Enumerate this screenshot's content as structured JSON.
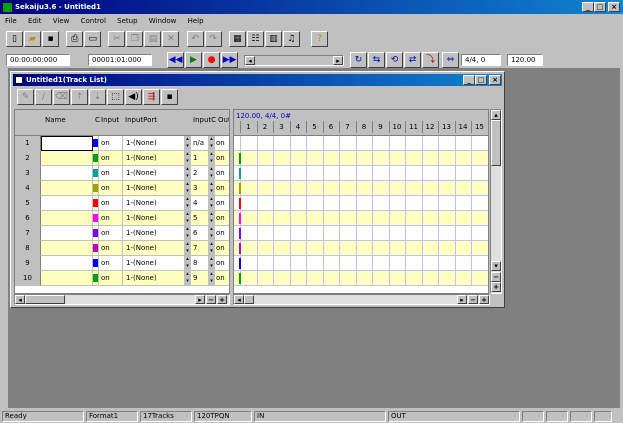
{
  "app": {
    "title": "Sekaiju3.6 - Untitled1"
  },
  "menu": [
    "File",
    "Edit",
    "View",
    "Control",
    "Setup",
    "Window",
    "Help"
  ],
  "transport": {
    "time": "00:00:00:000",
    "measure": "00001:01:000",
    "beat": "4/4, 0",
    "tempo": "120.00"
  },
  "child": {
    "title": "Untitled1(Track List)",
    "headers": {
      "name": "Name",
      "c": "C",
      "input": "Input",
      "inputport": "InputPort",
      "inputc": "InputC",
      "outp": "Outp"
    },
    "ruler": {
      "info": "120.00, 4/4, 0#",
      "measures": [
        "1",
        "2",
        "3",
        "4",
        "5",
        "6",
        "7",
        "8",
        "9",
        "10",
        "11",
        "12",
        "13",
        "14",
        "15"
      ]
    },
    "rows": [
      {
        "num": "1",
        "color": "#0000ff",
        "input": "on",
        "port": "1-(None)",
        "ch": "n/a",
        "out": "on",
        "mark": "#2e8b57"
      },
      {
        "num": "2",
        "color": "#00a000",
        "input": "on",
        "port": "1-(None)",
        "ch": "1",
        "out": "on",
        "mark": "#00a000"
      },
      {
        "num": "3",
        "color": "#00a0a0",
        "input": "on",
        "port": "1-(None)",
        "ch": "2",
        "out": "on",
        "mark": "#00a0a0"
      },
      {
        "num": "4",
        "color": "#a0a000",
        "input": "on",
        "port": "1-(None)",
        "ch": "3",
        "out": "on",
        "mark": "#a0a000"
      },
      {
        "num": "5",
        "color": "#ff0000",
        "input": "on",
        "port": "1-(None)",
        "ch": "4",
        "out": "on",
        "mark": "#ff0000"
      },
      {
        "num": "6",
        "color": "#ff00ff",
        "input": "on",
        "port": "1-(None)",
        "ch": "5",
        "out": "on",
        "mark": "#ff00ff"
      },
      {
        "num": "7",
        "color": "#8000ff",
        "input": "on",
        "port": "1-(None)",
        "ch": "6",
        "out": "on",
        "mark": "#8000ff"
      },
      {
        "num": "8",
        "color": "#c000c0",
        "input": "on",
        "port": "1-(None)",
        "ch": "7",
        "out": "on",
        "mark": "#c000c0"
      },
      {
        "num": "9",
        "color": "#0000ff",
        "input": "on",
        "port": "1-(None)",
        "ch": "8",
        "out": "on",
        "mark": "#0000ff"
      },
      {
        "num": "10",
        "color": "#00a000",
        "input": "on",
        "port": "1-(None)",
        "ch": "9",
        "out": "on",
        "mark": "#00a000"
      }
    ]
  },
  "status": {
    "ready": "Ready",
    "format": "Format1",
    "tracks": "17Tracks",
    "tpqn": "120TPQN",
    "in": "IN",
    "out": "OUT"
  }
}
